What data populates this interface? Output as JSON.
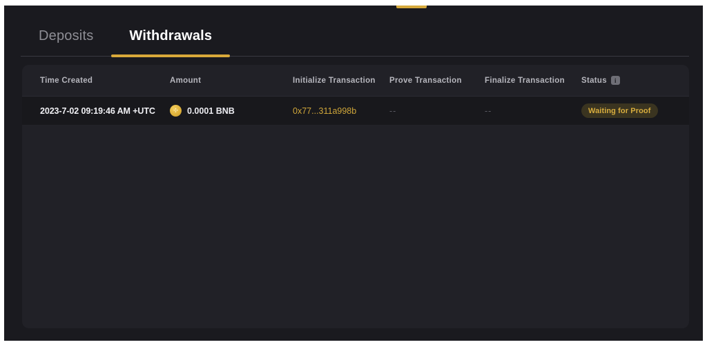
{
  "theme": {
    "page_bg": "#1a1a1f",
    "card_bg": "#212127",
    "row_bg": "#18181c",
    "accent": "#d9a93a",
    "badge_bg": "#3a3420",
    "badge_text": "#d8ad3e",
    "link": "#cfa63a"
  },
  "tabs": [
    {
      "label": "Deposits",
      "active": false
    },
    {
      "label": "Withdrawals",
      "active": true
    }
  ],
  "table": {
    "columns": [
      "Time Created",
      "Amount",
      "Initialize Transaction",
      "Prove Transaction",
      "Finalize Transaction",
      "Status"
    ],
    "status_info_icon": "info-icon",
    "status_info_glyph": "i",
    "rows": [
      {
        "time_created": "2023-7-02 09:19:46 AM +UTC",
        "amount_icon": "bnb-coin-icon",
        "amount": "0.0001 BNB",
        "initialize_transaction": "0x77...311a998b",
        "prove_transaction": "--",
        "finalize_transaction": "--",
        "status": "Waiting for Proof"
      }
    ]
  }
}
